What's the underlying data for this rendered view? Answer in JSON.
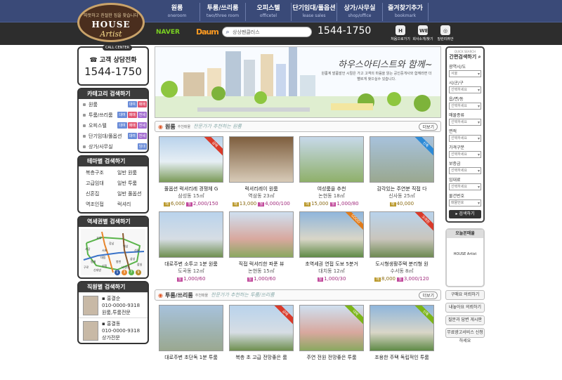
{
  "logo": {
    "tagline": "따뜻하고 친절한 집을 찾습니다",
    "line1": "HOUSE",
    "line2": "Artist"
  },
  "gnb": [
    {
      "ko": "원룸",
      "en": "oneroom"
    },
    {
      "ko": "투룸/쓰리룸",
      "en": "two/three room"
    },
    {
      "ko": "오피스텔",
      "en": "officetel"
    },
    {
      "ko": "단기임대/풀옵션",
      "en": "lease sales"
    },
    {
      "ko": "상가/사무실",
      "en": "shop/office"
    },
    {
      "ko": "즐겨찾기추가",
      "en": "bookmark"
    }
  ],
  "portals": {
    "naver": "NAVER",
    "daum": "Daum"
  },
  "search": {
    "value": "상상펜클러스",
    "placeholder": "상상펜클러스터 지세요"
  },
  "top_phone": "1544-1750",
  "quick_icons": [
    {
      "badge": "H",
      "label": "처음으로가기"
    },
    {
      "badge": "WE",
      "label": "회사소개/찾기"
    },
    {
      "badge": "◎",
      "label": "밀린리뷰안"
    }
  ],
  "call": {
    "tag": "CALL CENTER",
    "title": "고객 상담전화",
    "number": "1544-1750"
  },
  "category": {
    "title": "카테고리 검색하기",
    "items": [
      {
        "name": "원룸",
        "badges": [
          "대여",
          "매매"
        ]
      },
      {
        "name": "투룸/쓰리룸",
        "badges": [
          "대여",
          "매매",
          "전세"
        ]
      },
      {
        "name": "오피스텔",
        "badges": [
          "대여",
          "매매",
          "전세"
        ]
      },
      {
        "name": "단기임대/풀옵션",
        "badges": [
          "대여",
          "전세"
        ]
      },
      {
        "name": "상가/사무실",
        "badges": [
          "임대"
        ]
      }
    ]
  },
  "theme": {
    "title": "테마별 검색하기",
    "items": [
      "복층구조",
      "일반 원룸",
      "고급임대",
      "일반 투룸",
      "신혼집",
      "일반 풀옵션",
      "역조인접",
      "럭셔리"
    ]
  },
  "station": {
    "title": "역세권별 검색하기",
    "stations": [
      "강남",
      "교대",
      "역삼",
      "선릉",
      "사당",
      "서초",
      "방배",
      "신림",
      "신대방",
      "봉천",
      "낙성대",
      "구로",
      "대림",
      "삼성",
      "잠실"
    ],
    "line_numbers": [
      "1",
      "3",
      "7",
      "9"
    ]
  },
  "staff": {
    "title": "직원별 검색하기",
    "people": [
      {
        "name": "▪ 홍결순",
        "phone": "010-0000-9318",
        "duty": "원룸,투룸전문"
      },
      {
        "name": "▪ 홍결동",
        "phone": "010-0000-9318",
        "duty": "상가전문"
      }
    ]
  },
  "banner": {
    "title": "하우스아티스트와 함께~",
    "text": "원룸계 발품발언 시절은 가고 고객의 마음을 읽는 공인중개사와 함께라면 더 빨르게 찾으실수 있습니다."
  },
  "sections": [
    {
      "name": "원룸",
      "sub": "추천매물",
      "handwriting": "전문가가 추천하는 원룸",
      "more": "더보기",
      "items": [
        {
          "title": "풀옵션 럭셔리레 경쟁체 G",
          "loc": "삼성동 15㎡",
          "p1": "6,000",
          "p2": "2,000/150",
          "ribbon": "급매",
          "ribbon_color": "#d93a2a"
        },
        {
          "title": "럭셔리레이 원룸",
          "loc": "역삼동 23㎡",
          "p1": "13,000",
          "p2": "4,000/100",
          "ribbon": "",
          "ribbon_color": ""
        },
        {
          "title": "여성룸을 추천",
          "loc": "논현동 18㎡",
          "p1": "15,000",
          "p2": "1,000/80",
          "ribbon": "",
          "ribbon_color": ""
        },
        {
          "title": "감각있는 주연분 직접 다",
          "loc": "신사동 25㎡",
          "p1": "40,000",
          "p2": "",
          "ribbon": "신축",
          "ribbon_color": "#2d8ad6"
        },
        {
          "title": "대로주변 소투고 1분 원룸",
          "loc": "도곡동 12㎡",
          "p1": "",
          "p2": "1,000/60",
          "ribbon": "",
          "ribbon_color": ""
        },
        {
          "title": "직접 럭셔리한 파푼 뷰",
          "loc": "논현동 15㎡",
          "p1": "",
          "p2": "1,000/60",
          "ribbon": "",
          "ribbon_color": ""
        },
        {
          "title": "초역세권 연접 도보 5분거",
          "loc": "대치동 12㎡",
          "p1": "",
          "p2": "1,000/30",
          "ribbon": "GOOD",
          "ribbon_color": "#e07b1a"
        },
        {
          "title": "도시형생활주택 분리형 원",
          "loc": "수서동 8㎡",
          "p1": "8,000",
          "p2": "3,000/120",
          "ribbon": "오래된",
          "ribbon_color": "#d93a2a"
        }
      ]
    },
    {
      "name": "투룸/쓰리룸",
      "sub": "추천매물",
      "handwriting": "전문가가 추천하는 투룸/쓰리룸",
      "more": "더보기",
      "items": [
        {
          "title": "대로주변 초단독 1분 투룸",
          "loc": "",
          "p1": "",
          "p2": "",
          "ribbon": "",
          "ribbon_color": ""
        },
        {
          "title": "복층 초 고급 전망좋은 룸",
          "loc": "",
          "p1": "",
          "p2": "",
          "ribbon": "급매",
          "ribbon_color": "#d93a2a"
        },
        {
          "title": "주연 전원 전망좋은 투룸",
          "loc": "",
          "p1": "",
          "p2": "",
          "ribbon": "대박",
          "ribbon_color": "#7cb518"
        },
        {
          "title": "조용한 주택 독립적인 투룸",
          "loc": "",
          "p1": "",
          "p2": "",
          "ribbon": "신축",
          "ribbon_color": "#7cb518"
        }
      ]
    }
  ],
  "quick_search": {
    "tag": "QUICK SEARCH",
    "title": "간편검색하기",
    "fields": [
      {
        "label": "광역시/도",
        "value": "서울"
      },
      {
        "label": "시/군/구",
        "value": "선택하세요"
      },
      {
        "label": "읍/면/동",
        "value": "선택하세요"
      },
      {
        "label": "매물종류",
        "value": "선택하세요"
      },
      {
        "label": "면적",
        "value": "선택하세요"
      },
      {
        "label": "가격구분",
        "value": "선택하세요"
      },
      {
        "label": "보증금",
        "value": "선택하세요"
      },
      {
        "label": "임대료",
        "value": "선택하세요"
      },
      {
        "label": "물건번호",
        "value": "매물번호"
      }
    ],
    "button": "▸ 검색하기"
  },
  "today": {
    "title": "오늘본매물",
    "body": "HOUSE Artist"
  },
  "right_buttons": [
    "구매요 의뢰하기",
    "내놓아요 의뢰하기",
    "질문과 답변 게시판",
    "무료광고서비스 신청하세요"
  ]
}
